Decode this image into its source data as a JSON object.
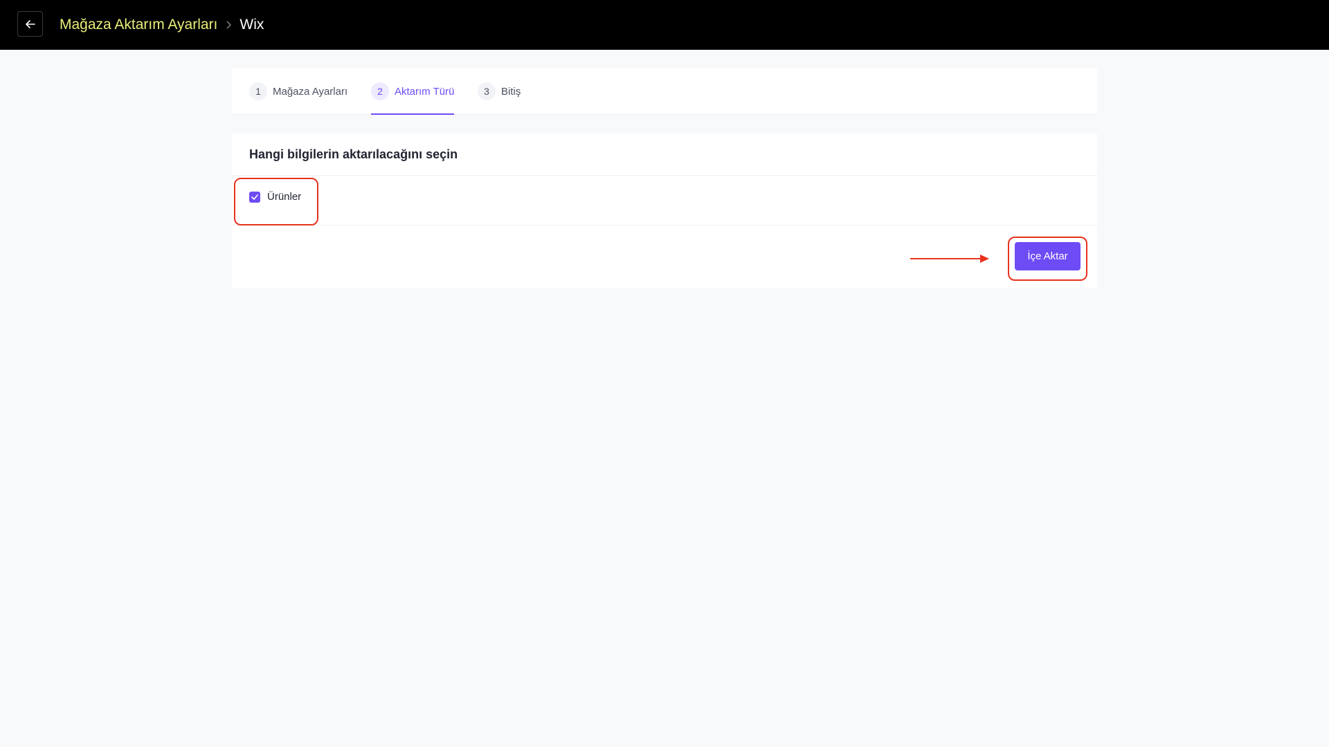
{
  "header": {
    "back_icon": "arrow-left-icon",
    "breadcrumb_parent": "Mağaza Aktarım Ayarları",
    "breadcrumb_separator_icon": "chevron-right-icon",
    "breadcrumb_current": "Wix"
  },
  "steps": [
    {
      "number": "1",
      "label": "Mağaza Ayarları",
      "active": false
    },
    {
      "number": "2",
      "label": "Aktarım Türü",
      "active": true
    },
    {
      "number": "3",
      "label": "Bitiş",
      "active": false
    }
  ],
  "form": {
    "title": "Hangi bilgilerin aktarılacağını seçin",
    "options": [
      {
        "label": "Ürünler",
        "checked": true
      }
    ],
    "submit_label": "İçe Aktar"
  },
  "colors": {
    "accent": "#6e4cf5",
    "breadcrumb_link": "#e9ef7a",
    "annotation": "#e8321e",
    "topbar": "#000000",
    "background": "#f8f9fb"
  }
}
